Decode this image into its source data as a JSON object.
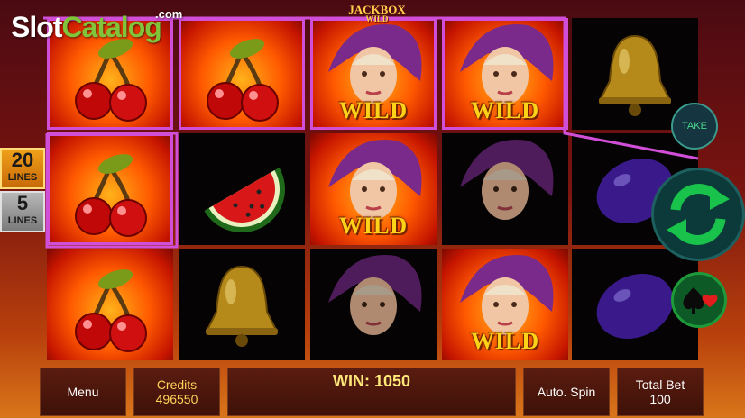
{
  "brand": {
    "part1": "Slot",
    "part2": "Catalog",
    "suffix": ".com"
  },
  "game_logo": {
    "line1": "JACKBOX",
    "line2": "WILD"
  },
  "lines": [
    {
      "number": "20",
      "label": "LINES"
    },
    {
      "number": "5",
      "label": "LINES"
    }
  ],
  "symbol_text": {
    "wild": "WILD"
  },
  "reels": [
    [
      "cherry",
      "cherry",
      "cherry"
    ],
    [
      "cherry",
      "watermelon",
      "bell"
    ],
    [
      "wild",
      "wild",
      "wild-lady"
    ],
    [
      "wild",
      "wild-lady",
      "wild"
    ],
    [
      "bell",
      "plum",
      "plum"
    ]
  ],
  "side_buttons": {
    "take_label": "TAKE",
    "spin_icon": "refresh-arrows-icon",
    "gamble_icon": "card-suits-icon"
  },
  "bottom_bar": {
    "menu_label": "Menu",
    "credits_label": "Credits",
    "credits_value": "496550",
    "win_text": "WIN: 1050",
    "autospin_label": "Auto. Spin",
    "total_bet_label": "Total Bet",
    "total_bet_value": "100"
  },
  "colors": {
    "highlight": "#d14fd8",
    "accent_gold": "#ffd21a",
    "spin_green": "#19c24a"
  }
}
